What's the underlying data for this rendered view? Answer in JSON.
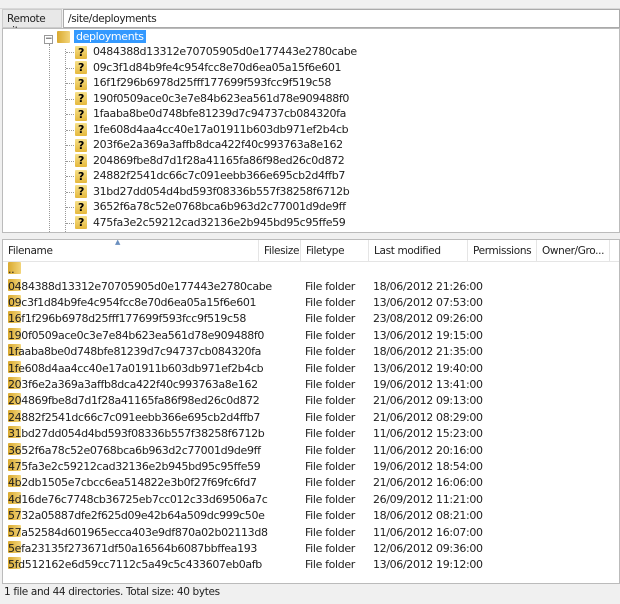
{
  "remote_site": {
    "label": "Remote site:",
    "path": "/site/deployments"
  },
  "tree": {
    "root": "deployments",
    "children": [
      "0484388d13312e70705905d0e177443e2780cabe",
      "09c3f1d84b9fe4c954fcc8e70d6ea05a15f6e601",
      "16f1f296b6978d25fff177699f593fcc9f519c58",
      "190f0509ace0c3e7e84b623ea561d78e909488f0",
      "1faaba8be0d748bfe81239d7c94737cb084320fa",
      "1fe608d4aa4cc40e17a01911b603db971ef2b4cb",
      "203f6e2a369a3affb8dca422f40c993763a8e162",
      "204869fbe8d7d1f28a41165fa86f98ed26c0d872",
      "24882f2541dc66c7c091eebb366e695cb2d4ffb7",
      "31bd27dd054d4bd593f08336b557f38258f6712b",
      "3652f6a78c52e0768bca6b963d2c77001d9de9ff",
      "475fa3e2c59212cad32136e2b945bd95c95ffe59"
    ]
  },
  "list": {
    "columns": [
      "Filename",
      "Filesize",
      "Filetype",
      "Last modified",
      "Permissions",
      "Owner/Gro..."
    ],
    "parent": "..",
    "rows": [
      [
        "0484388d13312e70705905d0e177443e2780cabe",
        "File folder",
        "18/06/2012 21:26:00"
      ],
      [
        "09c3f1d84b9fe4c954fcc8e70d6ea05a15f6e601",
        "File folder",
        "13/06/2012 07:53:00"
      ],
      [
        "16f1f296b6978d25fff177699f593fcc9f519c58",
        "File folder",
        "23/08/2012 09:26:00"
      ],
      [
        "190f0509ace0c3e7e84b623ea561d78e909488f0",
        "File folder",
        "13/06/2012 19:15:00"
      ],
      [
        "1faaba8be0d748bfe81239d7c94737cb084320fa",
        "File folder",
        "18/06/2012 21:35:00"
      ],
      [
        "1fe608d4aa4cc40e17a01911b603db971ef2b4cb",
        "File folder",
        "13/06/2012 19:40:00"
      ],
      [
        "203f6e2a369a3affb8dca422f40c993763a8e162",
        "File folder",
        "19/06/2012 13:41:00"
      ],
      [
        "204869fbe8d7d1f28a41165fa86f98ed26c0d872",
        "File folder",
        "21/06/2012 09:13:00"
      ],
      [
        "24882f2541dc66c7c091eebb366e695cb2d4ffb7",
        "File folder",
        "21/06/2012 08:29:00"
      ],
      [
        "31bd27dd054d4bd593f08336b557f38258f6712b",
        "File folder",
        "11/06/2012 15:23:00"
      ],
      [
        "3652f6a78c52e0768bca6b963d2c77001d9de9ff",
        "File folder",
        "11/06/2012 20:16:00"
      ],
      [
        "475fa3e2c59212cad32136e2b945bd95c95ffe59",
        "File folder",
        "19/06/2012 18:54:00"
      ],
      [
        "4b2db1505e7cbcc6ea514822e3b0f27f69fc6fd7",
        "File folder",
        "21/06/2012 16:06:00"
      ],
      [
        "4d16de76c7748cb36725eb7cc012c33d69506a7c",
        "File folder",
        "26/09/2012 11:21:00"
      ],
      [
        "5732a05887dfe2f625d09e42b64a509dc999c50e",
        "File folder",
        "18/06/2012 08:21:00"
      ],
      [
        "57a52584d601965ecca403e9df870a02b02113d8",
        "File folder",
        "11/06/2012 16:07:00"
      ],
      [
        "5efa23135f273671df50a16564b6087bbffea193",
        "File folder",
        "12/06/2012 09:36:00"
      ],
      [
        "5fd512162e6d59cc7112c5a49c5c433607eb0afb",
        "File folder",
        "13/06/2012 19:12:00"
      ]
    ]
  },
  "status": "1 file and 44 directories. Total size: 40 bytes"
}
